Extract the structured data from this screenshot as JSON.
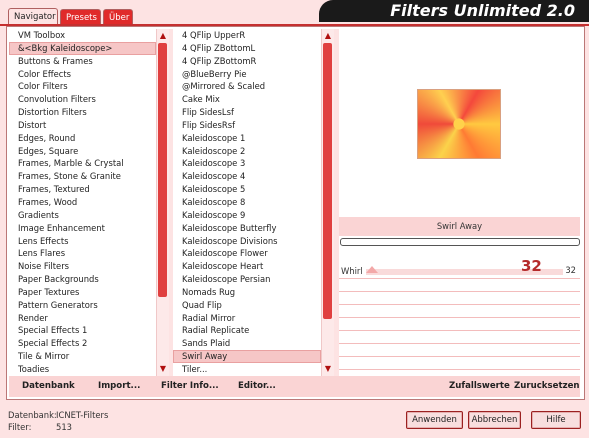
{
  "app": {
    "title": "Filters Unlimited 2.0"
  },
  "tabs": [
    {
      "label": "Navigator",
      "active": true
    },
    {
      "label": "Presets",
      "active": false
    },
    {
      "label": "Über",
      "active": false
    }
  ],
  "categories": {
    "items": [
      "VM Toolbox",
      "&<Bkg Kaleidoscope>",
      "Buttons & Frames",
      "Color Effects",
      "Color Filters",
      "Convolution Filters",
      "Distortion Filters",
      "Distort",
      "Edges, Round",
      "Edges, Square",
      "Frames, Marble & Crystal",
      "Frames, Stone & Granite",
      "Frames, Textured",
      "Frames, Wood",
      "Gradients",
      "Image Enhancement",
      "Lens Effects",
      "Lens Flares",
      "Noise Filters",
      "Paper Backgrounds",
      "Paper Textures",
      "Pattern Generators",
      "Render",
      "Special Effects 1",
      "Special Effects 2",
      "Tile & Mirror",
      "Toadies"
    ],
    "selected": "&<Bkg Kaleidoscope>"
  },
  "filters": {
    "items": [
      "4 QFlip UpperR",
      "4 QFlip ZBottomL",
      "4 QFlip ZBottomR",
      "@BlueBerry Pie",
      "@Mirrored & Scaled",
      "Cake Mix",
      "Flip SidesLsf",
      "Flip SidesRsf",
      "Kaleidoscope 1",
      "Kaleidoscope 2",
      "Kaleidoscope 3",
      "Kaleidoscope 4",
      "Kaleidoscope 5",
      "Kaleidoscope 8",
      "Kaleidoscope 9",
      "Kaleidoscope Butterfly",
      "Kaleidoscope Divisions",
      "Kaleidoscope Flower",
      "Kaleidoscope Heart",
      "Kaleidoscope Persian",
      "Nomads Rug",
      "Quad Flip",
      "Radial Mirror",
      "Radial Replicate",
      "Sands Plaid",
      "Swirl Away",
      "Tiler..."
    ],
    "selected": "Swirl Away"
  },
  "preview": {
    "filter_name": "Swirl Away"
  },
  "parameters": [
    {
      "label": "Whirl",
      "value": "32",
      "value_large": "32",
      "fraction": 0.0
    }
  ],
  "toolbar": {
    "datenbank": "Datenbank",
    "import": "Import...",
    "filter_info": "Filter Info...",
    "editor": "Editor...",
    "zufallswerte": "Zufallswerte",
    "zuruecksetzen": "Zurucksetzen"
  },
  "status": {
    "datenbank_label": "Datenbank:",
    "datenbank_value": "ICNET-Filters",
    "filter_label": "Filter:",
    "filter_value": "513"
  },
  "buttons": {
    "apply": "Anwenden",
    "cancel": "Abbrechen",
    "help": "Hilfe"
  },
  "colors": {
    "accent": "#e02a2a",
    "panel": "#fde3e3",
    "title_bg": "#1a1a1a"
  }
}
